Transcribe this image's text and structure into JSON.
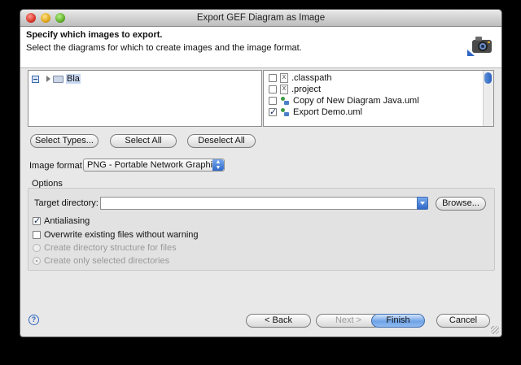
{
  "window": {
    "title": "Export GEF Diagram as Image"
  },
  "banner": {
    "title": "Specify which images to export.",
    "description": "Select the diagrams for which to create images and the image format.",
    "icon": "camera-icon"
  },
  "tree": {
    "items": [
      {
        "label": "Bla",
        "expanded": false,
        "selected": true,
        "icon": "folder-icon"
      }
    ]
  },
  "file_list": {
    "items": [
      {
        "label": ".classpath",
        "checked": false,
        "icon": "file-icon"
      },
      {
        "label": ".project",
        "checked": false,
        "icon": "file-icon"
      },
      {
        "label": "Copy of New Diagram Java.uml",
        "checked": false,
        "icon": "uml-icon"
      },
      {
        "label": "Export Demo.uml",
        "checked": true,
        "icon": "uml-icon"
      }
    ]
  },
  "selection_buttons": {
    "select_types": "Select Types...",
    "select_all": "Select All",
    "deselect_all": "Deselect All"
  },
  "image_format": {
    "label": "Image format",
    "value": "PNG - Portable Network Graphics"
  },
  "options": {
    "label": "Options",
    "target_directory_label": "Target directory:",
    "target_directory_value": "",
    "browse": "Browse...",
    "antialiasing": {
      "label": "Antialiasing",
      "checked": true
    },
    "overwrite": {
      "label": "Overwrite existing files without warning",
      "checked": false
    },
    "create_structure": {
      "label": "Create directory structure for files",
      "selected": false,
      "enabled": false
    },
    "create_selected": {
      "label": "Create only selected directories",
      "selected": true,
      "enabled": false
    }
  },
  "footer": {
    "help_icon": "?",
    "back": "< Back",
    "next": "Next >",
    "finish": "Finish",
    "cancel": "Cancel"
  },
  "colors": {
    "accent": "#3f6db0",
    "window_bg": "#e8e8e8"
  }
}
